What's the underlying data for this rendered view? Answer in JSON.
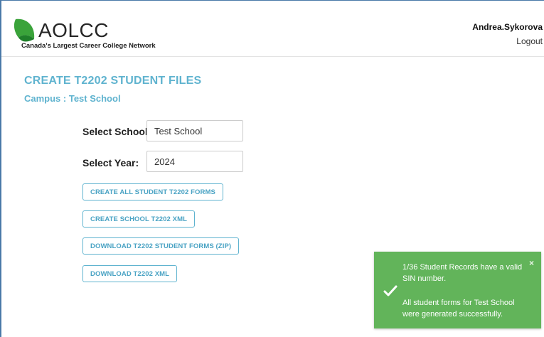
{
  "header": {
    "logo_text": "AOLCC",
    "logo_tagline": "Canada's Largest Career College Network",
    "user_name": "Andrea.Sykorova",
    "logout_label": "Logout"
  },
  "main": {
    "title": "CREATE T2202 STUDENT FILES",
    "campus": "Campus : Test School",
    "school_label": "Select School:",
    "school_value": "Test School",
    "year_label": "Select Year:",
    "year_value": "2024",
    "buttons": [
      {
        "label": "CREATE ALL STUDENT T2202 FORMS"
      },
      {
        "label": "CREATE SCHOOL T2202 XML"
      },
      {
        "label": "DOWNLOAD T2202 STUDENT FORMS (ZIP)"
      },
      {
        "label": "DOWNLOAD T2202 XML"
      }
    ]
  },
  "toast": {
    "message_line1": "1/36 Student Records have a valid SIN number.",
    "message_line2": "All student forms for Test School were generated successfully.",
    "close_symbol": "×",
    "icon": "checkmark-icon"
  },
  "colors": {
    "accent": "#5fb3cf",
    "toast_bg": "#62b45a",
    "logo_green": "#3aa33a"
  }
}
